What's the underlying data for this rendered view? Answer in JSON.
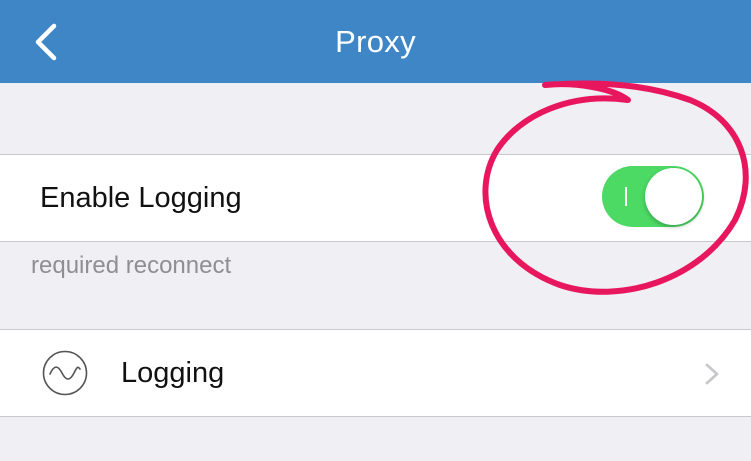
{
  "navbar": {
    "title": "Proxy",
    "back_icon": "chevron-left-icon",
    "background_color": "#3f86c6"
  },
  "settings": {
    "enable_logging": {
      "label": "Enable Logging",
      "enabled": true,
      "on_color": "#4cd964"
    },
    "footnote": "required reconnect",
    "logging_row": {
      "label": "Logging",
      "icon": "waveform-circle-icon",
      "accessory_icon": "chevron-right-icon"
    }
  },
  "annotation": {
    "shape": "hand-drawn circle",
    "color": "#e8175d"
  }
}
